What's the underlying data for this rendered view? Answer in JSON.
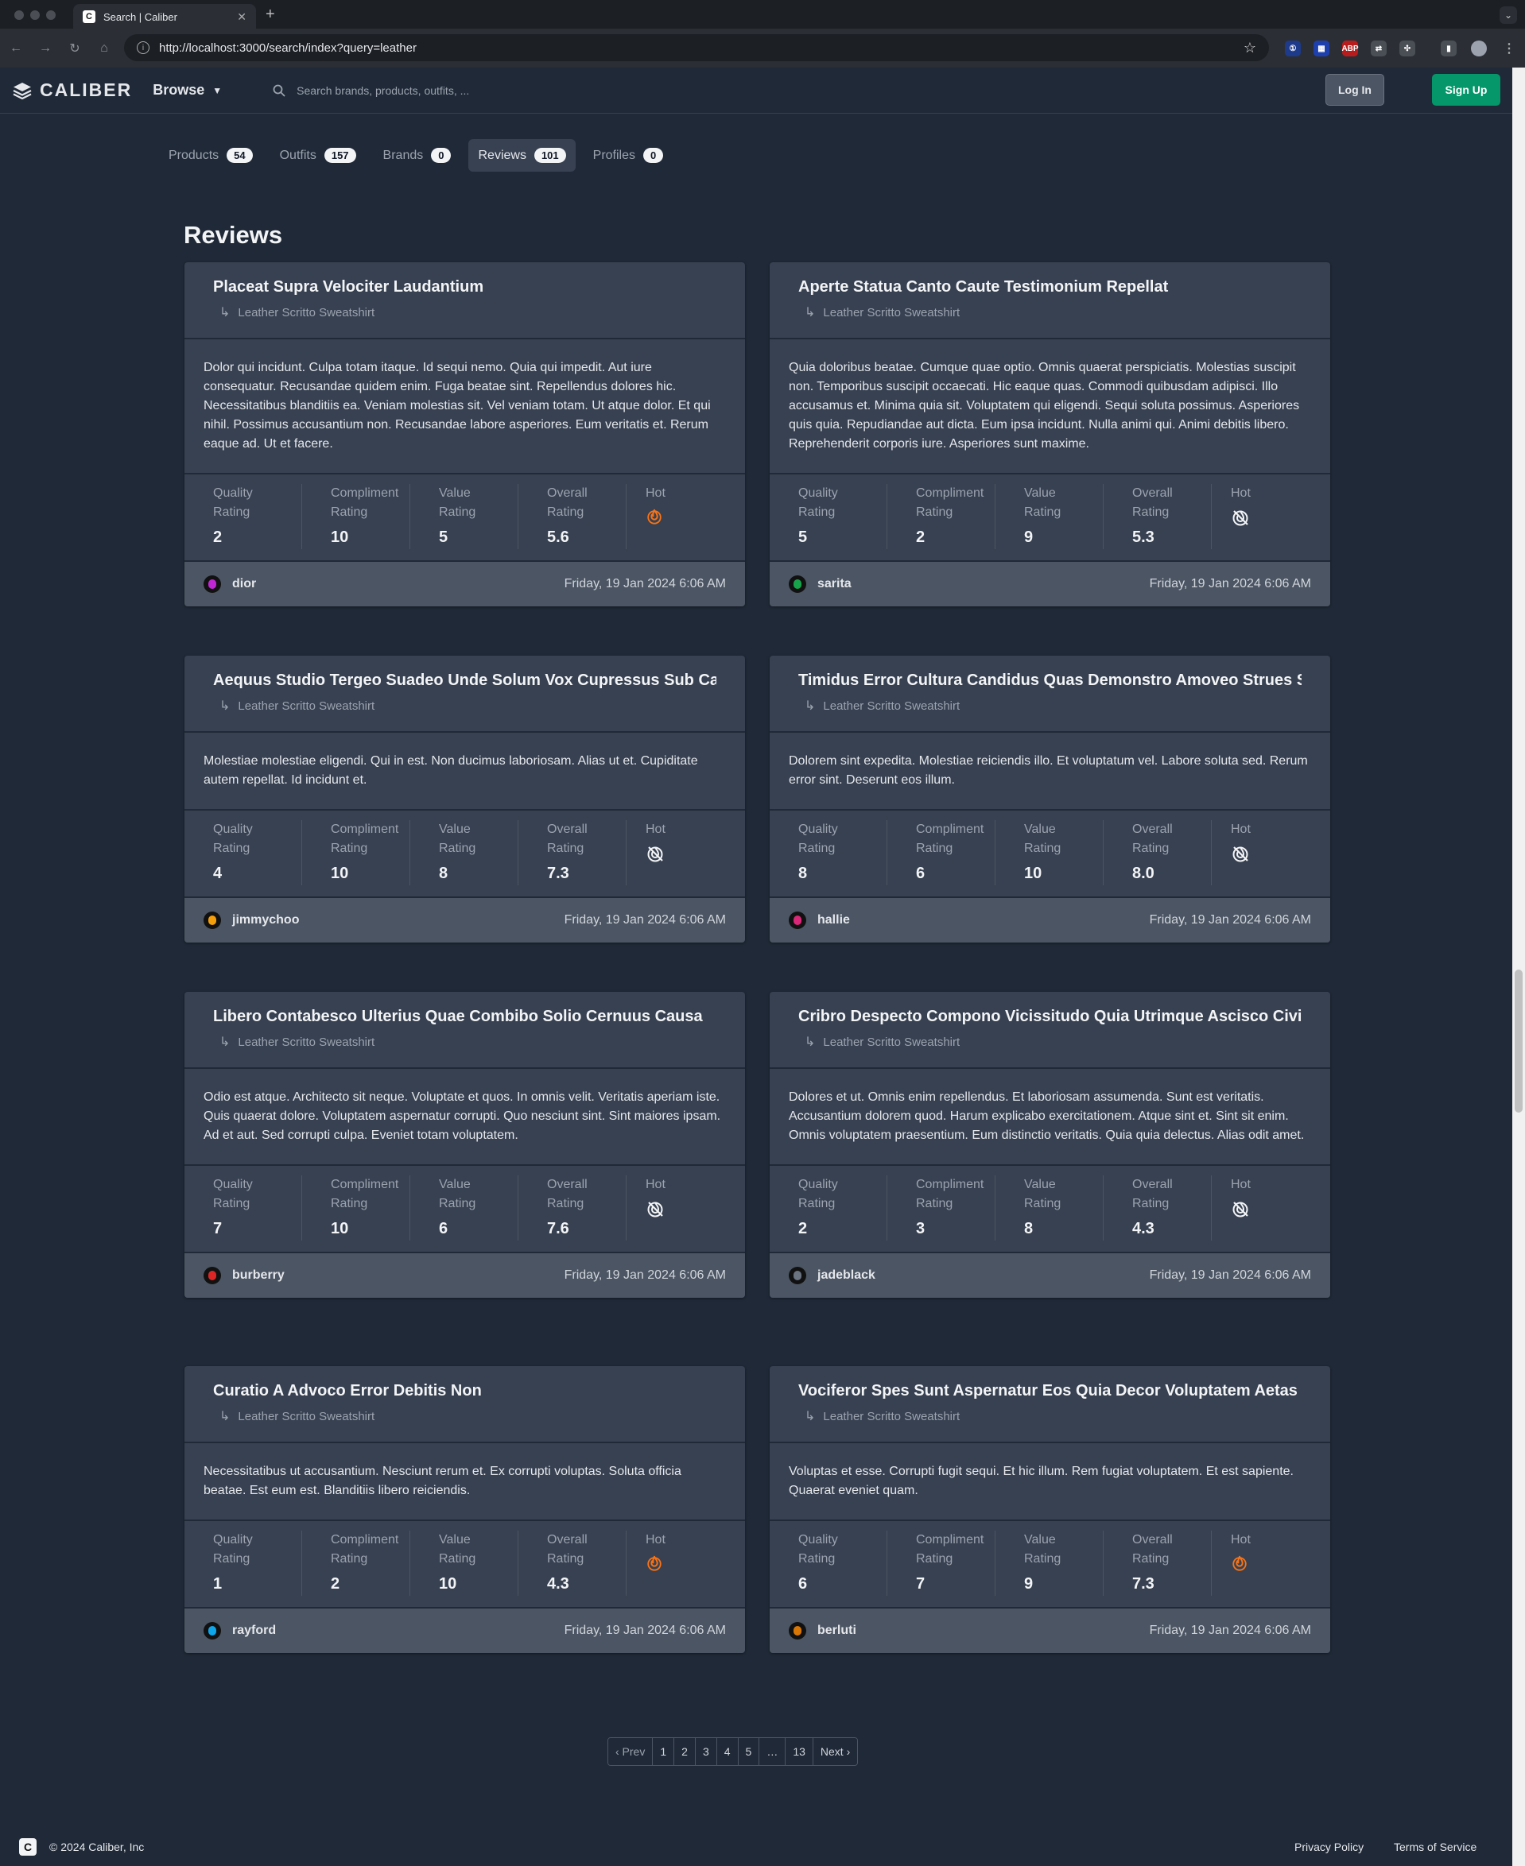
{
  "browser": {
    "tab_title": "Search | Caliber",
    "tab_favicon": "C",
    "url": "http://localhost:3000/search/index?query=leather"
  },
  "header": {
    "logo_text": "CALIBER",
    "browse_label": "Browse",
    "search_placeholder": "Search brands, products, outfits, ...",
    "login_label": "Log In",
    "signup_label": "Sign Up"
  },
  "search_tabs": [
    {
      "label": "Products",
      "count": "54",
      "active": false
    },
    {
      "label": "Outfits",
      "count": "157",
      "active": false
    },
    {
      "label": "Brands",
      "count": "0",
      "active": false
    },
    {
      "label": "Reviews",
      "count": "101",
      "active": true
    },
    {
      "label": "Profiles",
      "count": "0",
      "active": false
    }
  ],
  "section_title": "Reviews",
  "stat_labels": {
    "quality": [
      "Quality",
      "Rating"
    ],
    "compliment": [
      "Compliment",
      "Rating"
    ],
    "value": [
      "Value",
      "Rating"
    ],
    "overall": [
      "Overall",
      "Rating"
    ],
    "hot": "Hot"
  },
  "reviews": [
    {
      "title": "Placeat Supra Velociter Laudantium",
      "product": "Leather Scritto Sweatshirt",
      "body": "Dolor qui incidunt. Culpa totam itaque. Id sequi nemo. Quia qui impedit. Aut iure consequatur. Recusandae quidem enim. Fuga beatae sint. Repellendus dolores hic. Necessitatibus blanditiis ea. Veniam molestias sit. Vel veniam totam. Ut atque dolor. Et qui nihil. Possimus accusantium non. Recusandae labore asperiores. Eum veritatis et. Rerum eaque ad. Ut et facere.",
      "quality": "2",
      "compliment": "10",
      "value": "5",
      "overall": "5.6",
      "hot": true,
      "user": "dior",
      "avatar_color": "#c026d3",
      "date": "Friday, 19 Jan 2024 6:06 AM"
    },
    {
      "title": "Aperte Statua Canto Caute Testimonium Repellat",
      "product": "Leather Scritto Sweatshirt",
      "body": "Quia doloribus beatae. Cumque quae optio. Omnis quaerat perspiciatis. Molestias suscipit non. Temporibus suscipit occaecati. Hic eaque quas. Commodi quibusdam adipisci. Illo accusamus et. Minima quia sit. Voluptatem qui eligendi. Sequi soluta possimus. Asperiores quis quia. Repudiandae aut dicta. Eum ipsa incidunt. Nulla animi qui. Animi debitis libero. Reprehenderit corporis iure. Asperiores sunt maxime.",
      "quality": "5",
      "compliment": "2",
      "value": "9",
      "overall": "5.3",
      "hot": false,
      "user": "sarita",
      "avatar_color": "#16a34a",
      "date": "Friday, 19 Jan 2024 6:06 AM"
    },
    {
      "title": "Aequus Studio Tergeo Suadeo Unde Solum Vox Cupressus Sub Canonicus",
      "product": "Leather Scritto Sweatshirt",
      "body": "Molestiae molestiae eligendi. Qui in est. Non ducimus laboriosam. Alias ut et. Cupiditate autem repellat. Id incidunt et.",
      "quality": "4",
      "compliment": "10",
      "value": "8",
      "overall": "7.3",
      "hot": false,
      "user": "jimmychoo",
      "avatar_color": "#f59e0b",
      "date": "Friday, 19 Jan 2024 6:06 AM"
    },
    {
      "title": "Timidus Error Cultura Candidus Quas Demonstro Amoveo Strues Surgo",
      "product": "Leather Scritto Sweatshirt",
      "body": "Dolorem sint expedita. Molestiae reiciendis illo. Et voluptatum vel. Labore soluta sed. Rerum error sint. Deserunt eos illum.",
      "quality": "8",
      "compliment": "6",
      "value": "10",
      "overall": "8.0",
      "hot": false,
      "user": "hallie",
      "avatar_color": "#db2777",
      "date": "Friday, 19 Jan 2024 6:06 AM"
    },
    {
      "title": "Libero Contabesco Ulterius Quae Combibo Solio Cernuus Causa",
      "product": "Leather Scritto Sweatshirt",
      "body": "Odio est atque. Architecto sit neque. Voluptate et quos. In omnis velit. Veritatis aperiam iste. Quis quaerat dolore. Voluptatem aspernatur corrupti. Quo nesciunt sint. Sint maiores ipsam. Ad et aut. Sed corrupti culpa. Eveniet totam voluptatem.",
      "quality": "7",
      "compliment": "10",
      "value": "6",
      "overall": "7.6",
      "hot": false,
      "user": "burberry",
      "avatar_color": "#dc2626",
      "date": "Friday, 19 Jan 2024 6:06 AM"
    },
    {
      "title": "Cribro Despecto Compono Vicissitudo Quia Utrimque Ascisco Civis Damnatio",
      "product": "Leather Scritto Sweatshirt",
      "body": "Dolores et ut. Omnis enim repellendus. Et laboriosam assumenda. Sunt est veritatis. Accusantium dolorem quod. Harum explicabo exercitationem. Atque sint et. Sint sit enim. Omnis voluptatem praesentium. Eum distinctio veritatis. Quia quia delectus. Alias odit amet.",
      "quality": "2",
      "compliment": "3",
      "value": "8",
      "overall": "4.3",
      "hot": false,
      "user": "jadeblack",
      "avatar_color": "#6b7280",
      "date": "Friday, 19 Jan 2024 6:06 AM"
    },
    {
      "title": "Curatio A Advoco Error Debitis Non",
      "product": "Leather Scritto Sweatshirt",
      "body": "Necessitatibus ut accusantium. Nesciunt rerum et. Ex corrupti voluptas. Soluta officia beatae. Est eum est. Blanditiis libero reiciendis.",
      "quality": "1",
      "compliment": "2",
      "value": "10",
      "overall": "4.3",
      "hot": true,
      "user": "rayford",
      "avatar_color": "#0ea5e9",
      "date": "Friday, 19 Jan 2024 6:06 AM"
    },
    {
      "title": "Vociferor Spes Sunt Aspernatur Eos Quia Decor Voluptatem Aetas Caelum",
      "product": "Leather Scritto Sweatshirt",
      "body": "Voluptas et esse. Corrupti fugit sequi. Et hic illum. Rem fugiat voluptatem. Et est sapiente. Quaerat eveniet quam.",
      "quality": "6",
      "compliment": "7",
      "value": "9",
      "overall": "7.3",
      "hot": true,
      "user": "berluti",
      "avatar_color": "#d97706",
      "date": "Friday, 19 Jan 2024 6:06 AM"
    }
  ],
  "pagination": {
    "prev": "‹ Prev",
    "pages": [
      "1",
      "2",
      "3",
      "4",
      "5",
      "…",
      "13"
    ],
    "next": "Next ›"
  },
  "footer": {
    "logo": "C",
    "copyright": "© 2024 Caliber, Inc",
    "privacy": "Privacy Policy",
    "terms": "Terms of Service"
  },
  "colors": {
    "background": "#1f2937",
    "card": "#374151",
    "card_footer": "#4b5563",
    "accent_green": "#059669",
    "hot_orange": "#f97316"
  },
  "icons": {
    "hot_on": "flame-icon",
    "hot_off": "flame-off-icon"
  }
}
